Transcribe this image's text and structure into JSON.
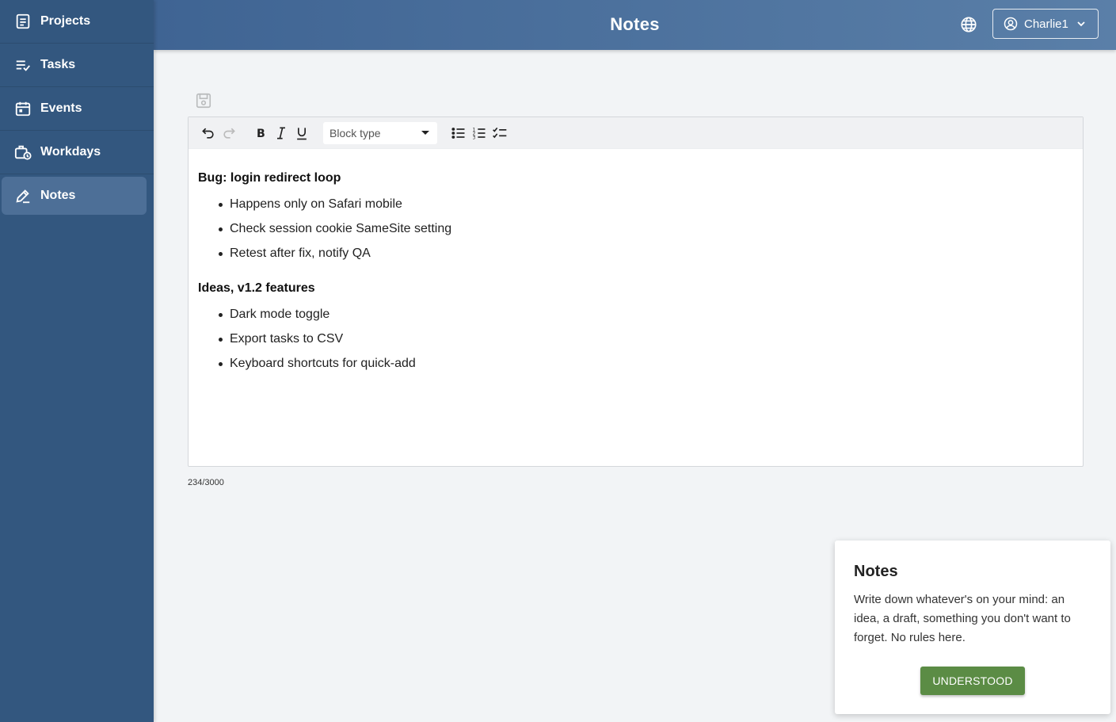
{
  "sidebar": {
    "items": [
      {
        "label": "Projects",
        "icon": "document-icon",
        "active": false
      },
      {
        "label": "Tasks",
        "icon": "task-list-icon",
        "active": false
      },
      {
        "label": "Events",
        "icon": "calendar-icon",
        "active": false
      },
      {
        "label": "Workdays",
        "icon": "briefcase-clock-icon",
        "active": false
      },
      {
        "label": "Notes",
        "icon": "pencil-icon",
        "active": true
      }
    ]
  },
  "header": {
    "title": "Notes",
    "user": "Charlie1"
  },
  "editor": {
    "block_type_placeholder": "Block type",
    "sections": [
      {
        "heading": "Bug: login redirect loop",
        "items": [
          "Happens only on Safari mobile",
          "Check session cookie SameSite setting",
          "Retest after fix, notify QA"
        ]
      },
      {
        "heading": "Ideas, v1.2 features",
        "items": [
          "Dark mode toggle",
          "Export tasks to CSV",
          "Keyboard shortcuts for quick-add"
        ]
      }
    ],
    "char_count": "234/3000"
  },
  "popup": {
    "title": "Notes",
    "text": "Write down whatever's on your mind: an idea, a draft, something you don't want to forget. No rules here.",
    "button": "UNDERSTOOD"
  },
  "colors": {
    "sidebar": "#33577f",
    "header_start": "#3f6493",
    "header_end": "#5a7fa8",
    "accent_button": "#5b8c45"
  }
}
